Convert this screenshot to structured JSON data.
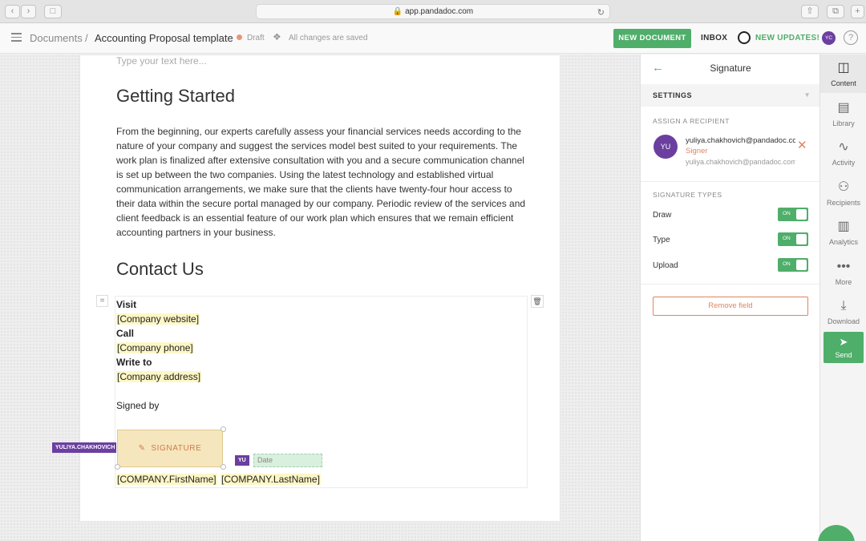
{
  "browser": {
    "url": "app.pandadoc.com"
  },
  "header": {
    "documents_label": "Documents",
    "separator": "/",
    "doc_title": "Accounting Proposal template",
    "status": "Draft",
    "saved_text": "All changes are saved",
    "new_document_label": "NEW DOCUMENT",
    "inbox_label": "INBOX",
    "updates_label": "NEW UPDATES!",
    "avatar_initials": "YC",
    "help_label": "?"
  },
  "document": {
    "placeholder": "Type your text here...",
    "heading1": "Getting Started",
    "paragraph": "From the beginning, our experts carefully assess your financial services needs according to the nature of your company and suggest the services model best suited to your requirements. The work plan is finalized after extensive consultation with you and a secure communication channel is set up between the two companies. Using the latest technology and established virtual communication arrangements, we make sure that the clients have twenty-four hour access to their data within the secure portal managed by our company. Periodic review of the services and client feedback is an essential feature of our work plan which ensures that we remain efficient accounting partners in your business.",
    "heading2": "Contact Us",
    "visit_label": "Visit",
    "website_field": "[Company website]",
    "call_label": "Call",
    "phone_field": "[Company phone]",
    "write_label": "Write to",
    "address_field": "[Company address]",
    "signed_by": "Signed by",
    "signature_label": "SIGNATURE",
    "signer_tag": "YULIYA.CHAKHOVICH",
    "date_tag": "YU",
    "date_placeholder": "Date",
    "firstname_field": "[COMPANY.FirstName]",
    "lastname_field": "[COMPANY.LastName]"
  },
  "panel": {
    "title": "Signature",
    "settings_label": "SETTINGS",
    "assign_label": "ASSIGN A RECIPIENT",
    "recipient": {
      "initials": "YU",
      "email": "yuliya.chakhovich@pandadoc.com",
      "role": "Signer",
      "email_secondary": "yuliya.chakhovich@pandadoc.com"
    },
    "types_label": "SIGNATURE TYPES",
    "types": [
      {
        "label": "Draw",
        "state": "ON"
      },
      {
        "label": "Type",
        "state": "ON"
      },
      {
        "label": "Upload",
        "state": "ON"
      }
    ],
    "remove_label": "Remove field"
  },
  "rail": {
    "content": "Content",
    "library": "Library",
    "activity": "Activity",
    "recipients": "Recipients",
    "analytics": "Analytics",
    "more": "More",
    "download": "Download",
    "send": "Send"
  },
  "colors": {
    "accent": "#4fae6a",
    "signer": "#6b3fa0",
    "warning": "#e0855f"
  }
}
